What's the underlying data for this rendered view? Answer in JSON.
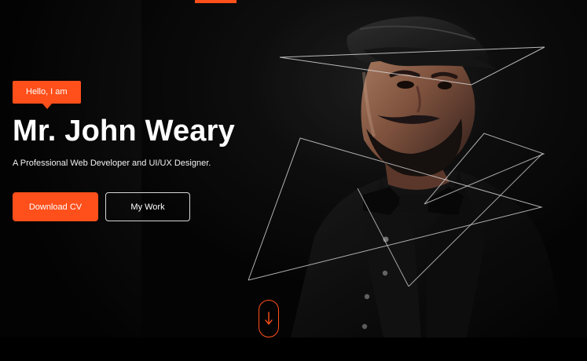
{
  "hero": {
    "greeting": "Hello, I am",
    "name": "Mr. John Weary",
    "subtitle": "A Professional Web Developer and UI/UX Designer."
  },
  "actions": {
    "download_label": "Download CV",
    "work_label": "My Work"
  },
  "icons": {
    "scroll": "arrow-down-icon"
  },
  "colors": {
    "accent": "#ff4f1a",
    "background": "#000000",
    "text": "#ffffff"
  }
}
